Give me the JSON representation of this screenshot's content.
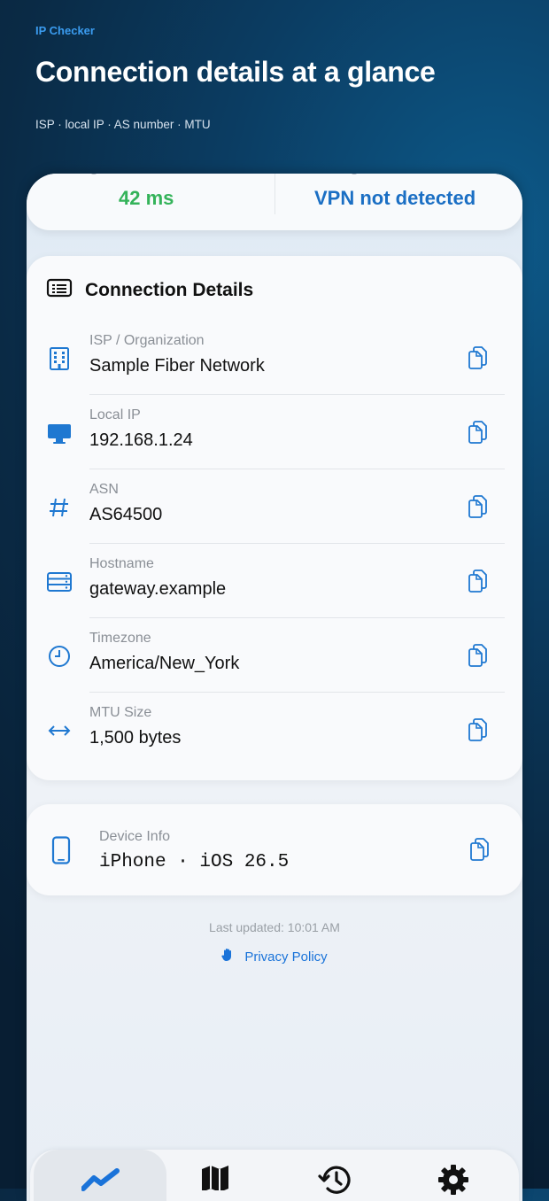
{
  "hero": {
    "app_name": "IP Checker",
    "title": "Connection details at a glance",
    "subtitle": "ISP · local IP · AS number · MTU"
  },
  "status": {
    "left_value": "42 ms",
    "left_color": "#34b35a",
    "right_value": "VPN not detected",
    "right_color": "#1b6fc4"
  },
  "connection": {
    "title": "Connection Details",
    "title_icon": "list-icon",
    "rows": [
      {
        "label": "ISP / Organization",
        "value": "Sample Fiber Network",
        "icon": "building-icon"
      },
      {
        "label": "Local IP",
        "value": "192.168.1.24",
        "icon": "monitor-icon"
      },
      {
        "label": "ASN",
        "value": "AS64500",
        "icon": "hash-icon"
      },
      {
        "label": "Hostname",
        "value": "gateway.example",
        "icon": "server-icon"
      },
      {
        "label": "Timezone",
        "value": "America/New_York",
        "icon": "clock-icon"
      },
      {
        "label": "MTU Size",
        "value": "1,500 bytes",
        "icon": "arrows-left-right-icon"
      }
    ]
  },
  "device": {
    "label": "Device Info",
    "value": "iPhone · iOS 26.5",
    "icon": "phone-icon"
  },
  "footer": {
    "last_updated": "Last updated: 10:01 AM",
    "privacy": "Privacy Policy",
    "privacy_icon": "hand-icon"
  },
  "tabs": [
    {
      "name": "overview",
      "icon": "chart-line-icon",
      "active": true
    },
    {
      "name": "map",
      "icon": "map-icon",
      "active": false
    },
    {
      "name": "history",
      "icon": "history-icon",
      "active": false
    },
    {
      "name": "settings",
      "icon": "gear-icon",
      "active": false
    }
  ],
  "colors": {
    "accent": "#1a73d9",
    "icon_blue": "#1f78d1"
  }
}
